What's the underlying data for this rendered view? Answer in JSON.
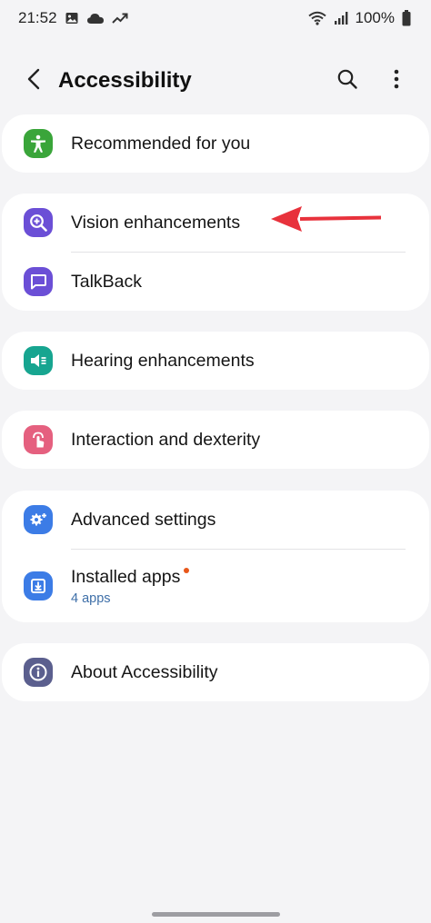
{
  "status_bar": {
    "time": "21:52",
    "battery": "100%",
    "icons": [
      "image-icon",
      "cloud-icon",
      "trend-icon",
      "wifi-icon",
      "signal-icon",
      "battery-icon"
    ]
  },
  "app_bar": {
    "title": "Accessibility",
    "back_icon": "back-chevron-icon",
    "search_icon": "search-icon",
    "more_icon": "more-vert-icon"
  },
  "groups": [
    {
      "items": [
        {
          "label": "Recommended for you",
          "icon": "accessibility-person-icon",
          "color": "#3aa53a"
        }
      ]
    },
    {
      "items": [
        {
          "label": "Vision enhancements",
          "icon": "zoom-in-icon",
          "color": "#6b4fd6"
        },
        {
          "label": "TalkBack",
          "icon": "chat-bubble-icon",
          "color": "#6b4fd6"
        }
      ]
    },
    {
      "items": [
        {
          "label": "Hearing enhancements",
          "icon": "volume-icon",
          "color": "#17a590"
        }
      ]
    },
    {
      "items": [
        {
          "label": "Interaction and dexterity",
          "icon": "touch-icon",
          "color": "#e5607f"
        }
      ]
    },
    {
      "items": [
        {
          "label": "Advanced settings",
          "icon": "gear-plus-icon",
          "color": "#3c7ce6"
        },
        {
          "label": "Installed apps",
          "sub": "4 apps",
          "icon": "download-box-icon",
          "color": "#3c7ce6",
          "badge_color": "#e8571a"
        }
      ]
    },
    {
      "items": [
        {
          "label": "About Accessibility",
          "icon": "info-icon",
          "color": "#5b5f8e"
        }
      ]
    }
  ],
  "annotation": {
    "arrow_color": "#e8323c"
  }
}
